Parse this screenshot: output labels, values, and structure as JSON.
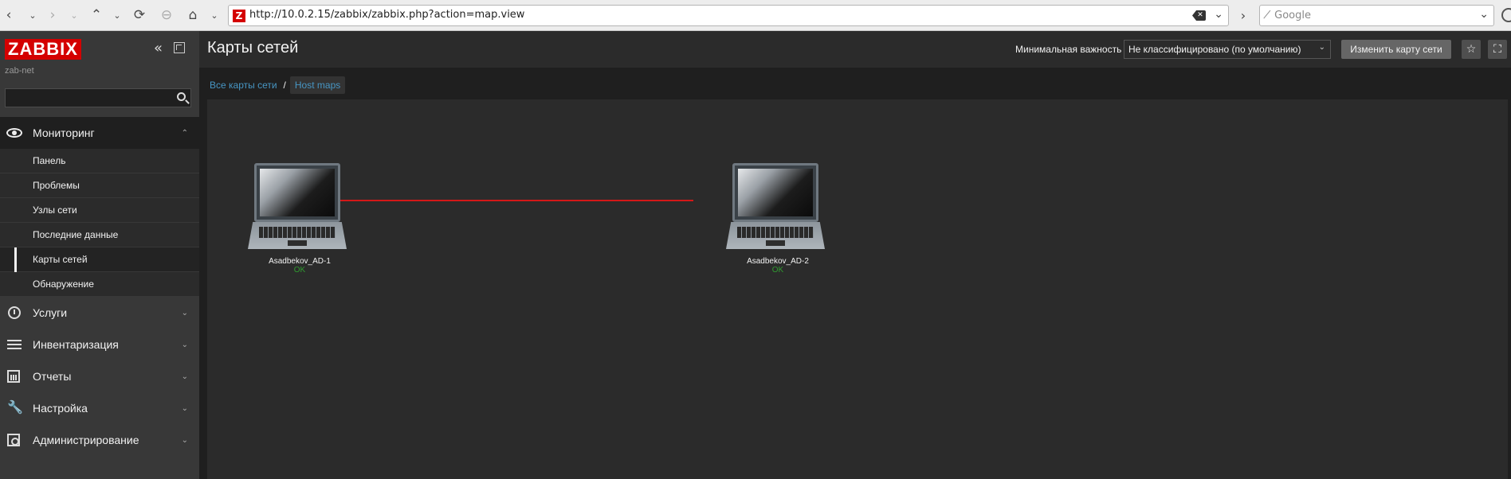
{
  "browser": {
    "url": "http://10.0.2.15/zabbix/zabbix.php?action=map.view",
    "favicon_letter": "Z",
    "search_placeholder": "̸ Google"
  },
  "sidebar": {
    "logo": "ZABBIX",
    "server_name": "zab-net",
    "search_value": "",
    "menu": [
      {
        "label": "Мониторинг",
        "icon": "eye-icon",
        "expanded": true,
        "items": [
          {
            "label": "Панель"
          },
          {
            "label": "Проблемы"
          },
          {
            "label": "Узлы сети"
          },
          {
            "label": "Последние данные"
          },
          {
            "label": "Карты сетей",
            "selected": true
          },
          {
            "label": "Обнаружение"
          }
        ]
      },
      {
        "label": "Услуги",
        "icon": "clock-icon"
      },
      {
        "label": "Инвентаризация",
        "icon": "list-icon"
      },
      {
        "label": "Отчеты",
        "icon": "report-icon"
      },
      {
        "label": "Настройка",
        "icon": "wrench-icon"
      },
      {
        "label": "Администрирование",
        "icon": "gear-icon"
      }
    ]
  },
  "header": {
    "title": "Карты сетей",
    "severity_label": "Минимальная важность",
    "severity_value": "Не классифицировано (по умолчанию)",
    "edit_button": "Изменить карту сети"
  },
  "breadcrumb": {
    "all_maps": "Все карты сети",
    "separator": "/",
    "current": "Host maps"
  },
  "map": {
    "hosts": [
      {
        "name": "Asadbekov_AD-1",
        "status": "OK"
      },
      {
        "name": "Asadbekov_AD-2",
        "status": "OK"
      }
    ],
    "link_color": "#d41818",
    "status_color": "#2f9b2f"
  },
  "colors": {
    "brand": "#d40000",
    "link_text": "#4796c4"
  }
}
